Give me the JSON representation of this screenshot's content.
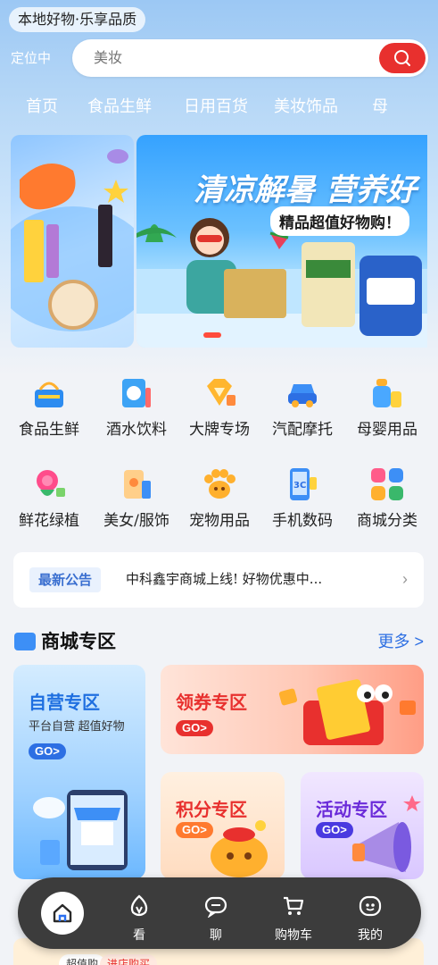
{
  "header": {
    "slogan": "本地好物·乐享品质",
    "location": "定位中",
    "search_placeholder": "美妆"
  },
  "categories": [
    "首页",
    "食品生鲜",
    "日用百货",
    "美妆饰品",
    "母"
  ],
  "banner": {
    "title": "清凉解暑 营养好",
    "subtitle": "精品超值好物购！"
  },
  "grid": [
    {
      "label": "食品生鲜",
      "icon": "basket-icon"
    },
    {
      "label": "酒水饮料",
      "icon": "drink-icon"
    },
    {
      "label": "大牌专场",
      "icon": "diamond-icon"
    },
    {
      "label": "汽配摩托",
      "icon": "car-icon"
    },
    {
      "label": "母婴用品",
      "icon": "baby-bottle-icon"
    },
    {
      "label": "鲜花绿植",
      "icon": "flower-icon"
    },
    {
      "label": "美女/服饰",
      "icon": "clothing-icon"
    },
    {
      "label": "宠物用品",
      "icon": "paw-icon"
    },
    {
      "label": "手机数码",
      "icon": "phone-icon"
    },
    {
      "label": "商城分类",
      "icon": "grid-icon"
    }
  ],
  "notice": {
    "tag": "最新公告",
    "text": "中科鑫宇商城上线! 好物优惠中..."
  },
  "section": {
    "title": "商城专区",
    "more": "更多 >"
  },
  "zones": {
    "self": {
      "title": "自营专区",
      "sub": "平台自营 超值好物",
      "go": "GO>"
    },
    "coupon": {
      "title": "领券专区",
      "go": "GO>"
    },
    "points": {
      "title": "积分专区",
      "go": "GO>"
    },
    "event": {
      "title": "活动专区",
      "go": "GO>"
    }
  },
  "peek": {
    "tag1": "超值购",
    "tag2": "进店购买"
  },
  "tabbar": [
    {
      "label": "",
      "icon": "home-icon"
    },
    {
      "label": "看",
      "icon": "watch-icon"
    },
    {
      "label": "聊",
      "icon": "chat-icon"
    },
    {
      "label": "购物车",
      "icon": "cart-icon"
    },
    {
      "label": "我的",
      "icon": "profile-icon"
    }
  ],
  "colors": {
    "accent": "#e8302e",
    "link": "#2d6fe3",
    "tabbar": "#3c3c3c"
  }
}
